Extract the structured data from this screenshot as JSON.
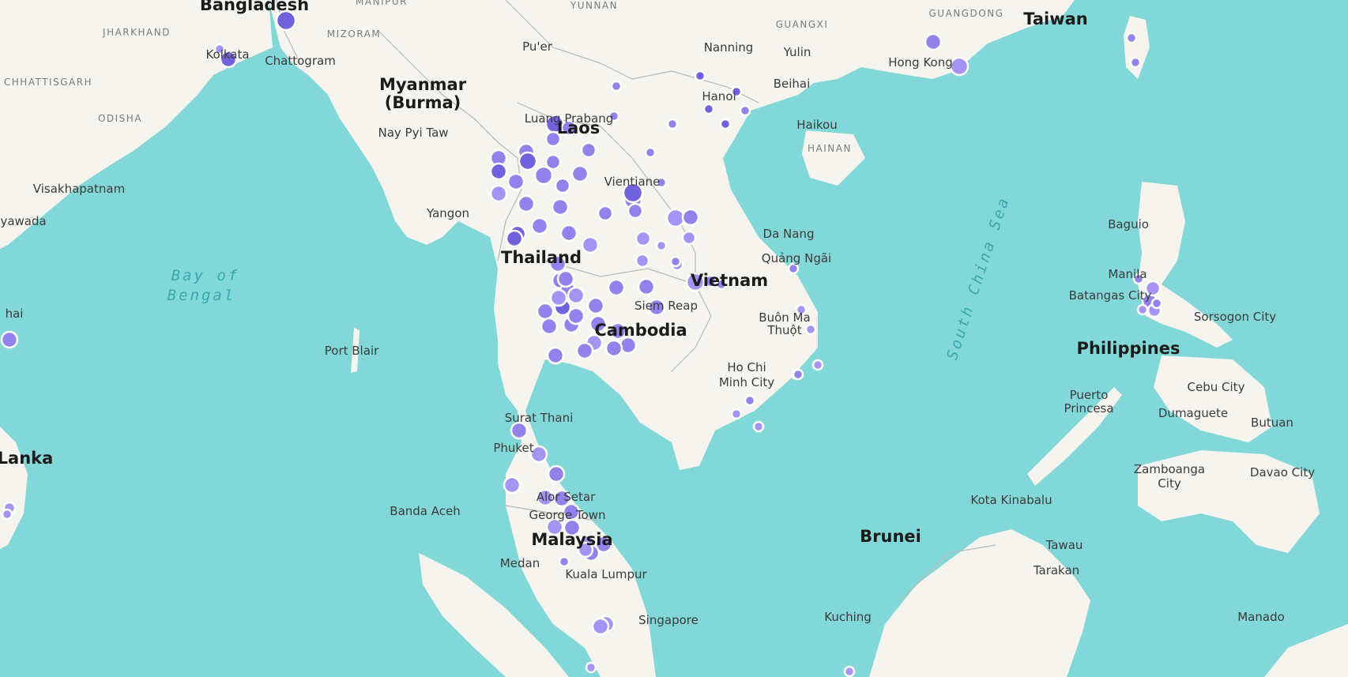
{
  "map": {
    "country_labels": [
      {
        "key": "bangladesh",
        "text": "Bangladesh"
      },
      {
        "key": "myanmar-1",
        "text": "Myanmar"
      },
      {
        "key": "myanmar-2",
        "text": "(Burma)"
      },
      {
        "key": "laos",
        "text": "Laos"
      },
      {
        "key": "thailand",
        "text": "Thailand"
      },
      {
        "key": "cambodia",
        "text": "Cambodia"
      },
      {
        "key": "vietnam",
        "text": "Vietnam"
      },
      {
        "key": "philippines",
        "text": "Philippines"
      },
      {
        "key": "malaysia",
        "text": "Malaysia"
      },
      {
        "key": "brunei",
        "text": "Brunei"
      },
      {
        "key": "taiwan",
        "text": "Taiwan"
      },
      {
        "key": "sri-lanka",
        "text": "Lanka"
      }
    ],
    "city_labels": [
      {
        "key": "kolkata",
        "text": "Kolkata"
      },
      {
        "key": "chattogram",
        "text": "Chattogram"
      },
      {
        "key": "puer",
        "text": "Pu'er"
      },
      {
        "key": "nanning",
        "text": "Nanning"
      },
      {
        "key": "yulin",
        "text": "Yulin"
      },
      {
        "key": "hong-kong",
        "text": "Hong Kong"
      },
      {
        "key": "beihai",
        "text": "Beihai"
      },
      {
        "key": "hanoi",
        "text": "Hanoi"
      },
      {
        "key": "haikou",
        "text": "Haikou"
      },
      {
        "key": "nay-pyi-taw",
        "text": "Nay Pyi Taw"
      },
      {
        "key": "luang-prabang",
        "text": "Luang Prabang"
      },
      {
        "key": "visakhapatnam",
        "text": "Visakhapatnam"
      },
      {
        "key": "vientiane",
        "text": "Vientiane"
      },
      {
        "key": "yangon",
        "text": "Yangon"
      },
      {
        "key": "vijayawada",
        "text": "ayawada"
      },
      {
        "key": "da-nang",
        "text": "Da Nang"
      },
      {
        "key": "quang-ngai",
        "text": "Quảng Ngãi"
      },
      {
        "key": "baguio",
        "text": "Baguio"
      },
      {
        "key": "manila",
        "text": "Manila"
      },
      {
        "key": "batangas",
        "text": "Batangas City"
      },
      {
        "key": "sorsogon",
        "text": "Sorsogon City"
      },
      {
        "key": "chennai",
        "text": "hai"
      },
      {
        "key": "port-blair",
        "text": "Port Blair"
      },
      {
        "key": "siem-reap",
        "text": "Siem Reap"
      },
      {
        "key": "buon-ma-thuot-1",
        "text": "Buôn Ma"
      },
      {
        "key": "buon-ma-thuot-2",
        "text": "Thuột"
      },
      {
        "key": "ho-chi-minh-1",
        "text": "Ho Chi"
      },
      {
        "key": "ho-chi-minh-2",
        "text": "Minh City"
      },
      {
        "key": "cebu",
        "text": "Cebu City"
      },
      {
        "key": "puerto-princesa-1",
        "text": "Puerto"
      },
      {
        "key": "puerto-princesa-2",
        "text": "Princesa"
      },
      {
        "key": "dumaguete",
        "text": "Dumaguete"
      },
      {
        "key": "butuan",
        "text": "Butuan"
      },
      {
        "key": "surat-thani",
        "text": "Surat Thani"
      },
      {
        "key": "phuket",
        "text": "Phuket"
      },
      {
        "key": "zamboanga-1",
        "text": "Zamboanga"
      },
      {
        "key": "zamboanga-2",
        "text": "City"
      },
      {
        "key": "davao",
        "text": "Davao City"
      },
      {
        "key": "alor-setar",
        "text": "Alor Setar"
      },
      {
        "key": "kota-kinabalu",
        "text": "Kota Kinabalu"
      },
      {
        "key": "banda-aceh",
        "text": "Banda Aceh"
      },
      {
        "key": "george-town",
        "text": "George Town"
      },
      {
        "key": "tawau",
        "text": "Tawau"
      },
      {
        "key": "medan",
        "text": "Medan"
      },
      {
        "key": "tarakan",
        "text": "Tarakan"
      },
      {
        "key": "kuala-lumpur",
        "text": "Kuala Lumpur"
      },
      {
        "key": "singapore",
        "text": "Singapore"
      },
      {
        "key": "kuching",
        "text": "Kuching"
      },
      {
        "key": "manado",
        "text": "Manado"
      }
    ],
    "region_labels": [
      {
        "key": "yunnan",
        "text": "YUNNAN"
      },
      {
        "key": "guangdong",
        "text": "GUANGDONG"
      },
      {
        "key": "guangxi",
        "text": "GUANGXI"
      },
      {
        "key": "jharkhand",
        "text": "JHARKHAND"
      },
      {
        "key": "mizoram",
        "text": "MIZORAM"
      },
      {
        "key": "manipur",
        "text": "MANIPUR"
      },
      {
        "key": "chhattisgarh",
        "text": "CHHATTISGARH"
      },
      {
        "key": "odisha",
        "text": "ODISHA"
      },
      {
        "key": "hainan",
        "text": "HAINAN"
      }
    ],
    "sea_labels": [
      {
        "key": "bay-of-bengal-1",
        "text": "Bay of"
      },
      {
        "key": "bay-of-bengal-2",
        "text": "Bengal"
      },
      {
        "key": "south-china-sea",
        "text": "South China Sea"
      }
    ],
    "colors": {
      "water": "#82d8d8",
      "land": "#f6f4ef",
      "border": "#b8b8b8",
      "marker_light": "#a594f3",
      "marker_mid": "#9182ec",
      "marker_dark": "#7062dd",
      "marker_stroke": "#ffffff"
    }
  }
}
